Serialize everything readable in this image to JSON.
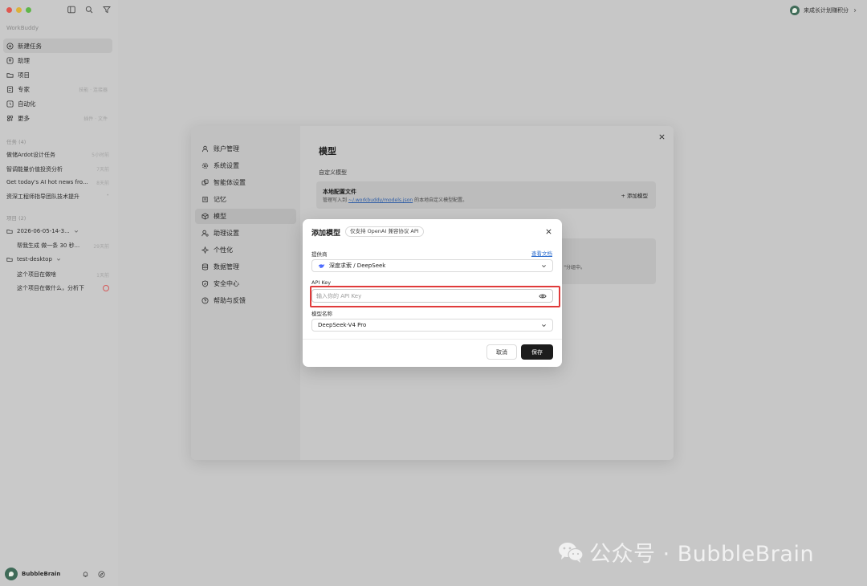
{
  "sidebar": {
    "workspace": "WorkBuddy",
    "nav": [
      {
        "label": "新建任务",
        "icon": "plus-circle-icon",
        "hint": ""
      },
      {
        "label": "助理",
        "icon": "assistant-icon",
        "hint": ""
      },
      {
        "label": "项目",
        "icon": "folder-icon",
        "hint": ""
      },
      {
        "label": "专家",
        "icon": "expert-icon",
        "hint": "技能 · 连接器"
      },
      {
        "label": "自动化",
        "icon": "clock-icon",
        "hint": ""
      },
      {
        "label": "更多",
        "icon": "more-icon",
        "hint": "插件 · 文件"
      }
    ],
    "tasks_header": "任务 (4)",
    "tasks": [
      {
        "title": "做储Ardot设计任务",
        "time": "5小时前"
      },
      {
        "title": "智调能量价值投资分析",
        "time": "7天前"
      },
      {
        "title": "Get today's AI hot news fro...",
        "time": "8天前"
      },
      {
        "title": "资深工程师指导团队技术提升",
        "time": "•"
      }
    ],
    "projects_header": "项目 (2)",
    "projects": [
      {
        "title": "2026-06-05-14-3...",
        "time": "",
        "level": 0
      },
      {
        "title": "帮我生成 做一条 30 秒...",
        "time": "29天前",
        "level": 1
      },
      {
        "title": "test-desktop",
        "time": "",
        "level": 0
      },
      {
        "title": "这个项目在做啥",
        "time": "1天前",
        "level": 1
      },
      {
        "title": "这个项目在做什么，分析下",
        "time": "",
        "level": 1
      }
    ],
    "user_name": "BubbleBrain"
  },
  "topbar": {
    "points_label": "来成长计划赚积分"
  },
  "settings": {
    "nav": [
      {
        "label": "账户管理",
        "icon": "user-icon"
      },
      {
        "label": "系统设置",
        "icon": "gear-icon"
      },
      {
        "label": "智能体设置",
        "icon": "agent-icon"
      },
      {
        "label": "记忆",
        "icon": "memory-icon"
      },
      {
        "label": "模型",
        "icon": "cube-icon"
      },
      {
        "label": "助理设置",
        "icon": "assistant-settings-icon"
      },
      {
        "label": "个性化",
        "icon": "sparkle-icon"
      },
      {
        "label": "数据管理",
        "icon": "database-icon"
      },
      {
        "label": "安全中心",
        "icon": "shield-icon"
      },
      {
        "label": "帮助与反馈",
        "icon": "help-icon"
      }
    ],
    "title": "模型",
    "custom_models_label": "自定义模型",
    "config_title": "本地配置文件",
    "config_desc_prefix": "管理写入到 ",
    "config_path": "~/.workbuddy/models.json",
    "config_desc_suffix": " 的本地自定义模型配置。",
    "add_model_label": "+ 添加模型",
    "card2_text": "\"分组中。"
  },
  "modal": {
    "title": "添加模型",
    "badge": "仅支持 OpenAI 兼容协议 API",
    "provider_label": "提供商",
    "docs_link": "查看文档",
    "provider_value": "深度求索 / DeepSeek",
    "api_key_label": "API Key",
    "api_key_placeholder": "输入你的 API Key",
    "model_name_label": "模型名称",
    "model_name_value": "DeepSeek-V4 Pro",
    "cancel_label": "取消",
    "save_label": "保存"
  },
  "watermark": {
    "text": "公众号 · BubbleBrain"
  }
}
